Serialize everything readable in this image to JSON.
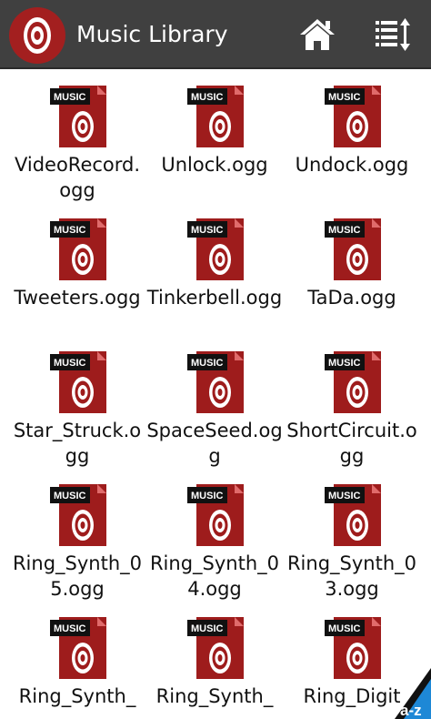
{
  "appbar": {
    "title": "Music Library",
    "icons": {
      "logo": "music-disc-icon",
      "home": "home-icon",
      "sort": "sort-list-icon"
    },
    "colors": {
      "background": "#404040",
      "accent": "#a31f1f"
    }
  },
  "file_icon": {
    "tag_label": "MUSIC",
    "name": "music-file-icon",
    "color": "#a31f1f"
  },
  "files": [
    {
      "name": "VideoRecord.ogg"
    },
    {
      "name": "Unlock.ogg"
    },
    {
      "name": "Undock.ogg"
    },
    {
      "name": "Tweeters.ogg"
    },
    {
      "name": "Tinkerbell.ogg"
    },
    {
      "name": "TaDa.ogg"
    },
    {
      "name": "Star_Struck.ogg"
    },
    {
      "name": "SpaceSeed.ogg"
    },
    {
      "name": "ShortCircuit.ogg"
    },
    {
      "name": "Ring_Synth_05.ogg"
    },
    {
      "name": "Ring_Synth_04.ogg"
    },
    {
      "name": "Ring_Synth_03.ogg"
    },
    {
      "name": "Ring_Synth_"
    },
    {
      "name": "Ring_Synth_"
    },
    {
      "name": "Ring_Digit"
    }
  ],
  "az_badge": {
    "label": "a-z",
    "color": "#1e88d6"
  }
}
